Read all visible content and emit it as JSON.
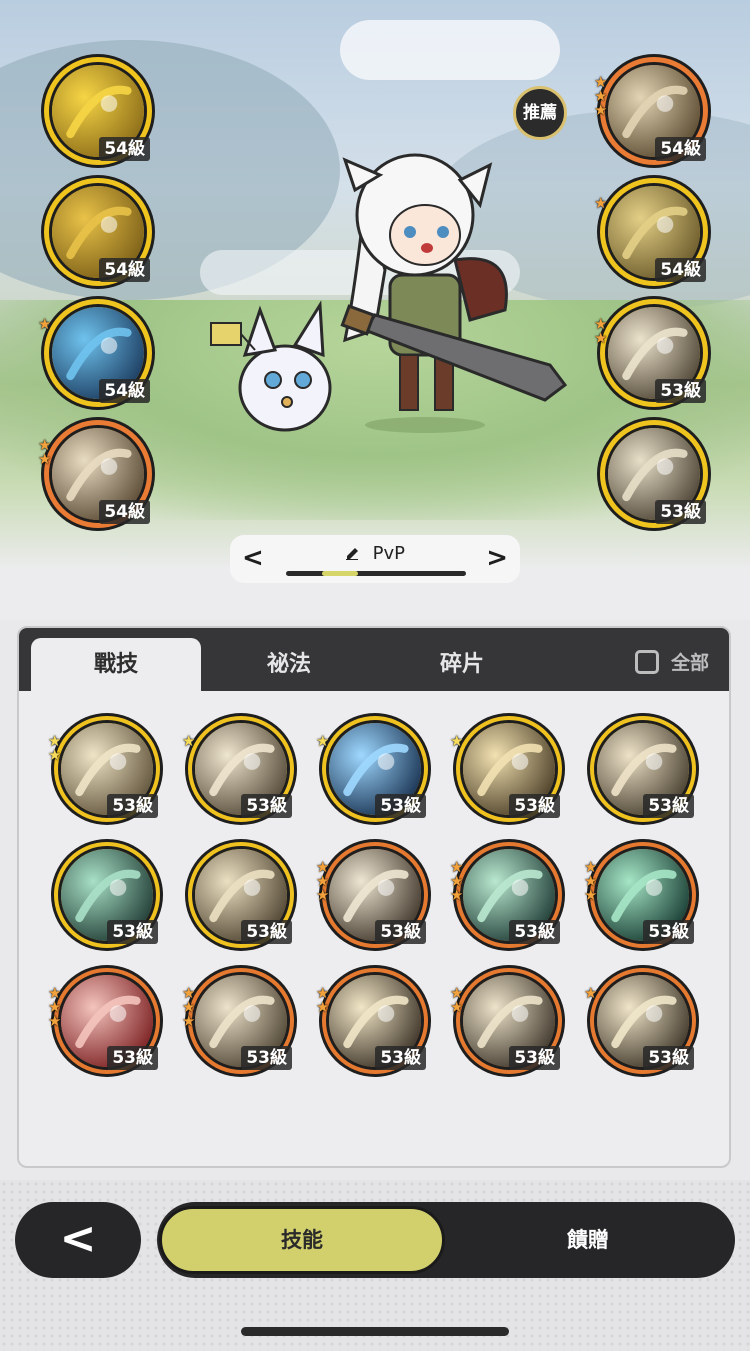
{
  "scene": {
    "recommend_label": "推薦",
    "left_slots": [
      {
        "level": "54級",
        "frame": "gold",
        "stars": 0,
        "icon": "golden-crystal-arrows-icon"
      },
      {
        "level": "54級",
        "frame": "gold",
        "stars": 0,
        "icon": "golden-rune-square-icon"
      },
      {
        "level": "54級",
        "frame": "gold",
        "stars": 1,
        "icon": "blue-magic-circle-icon"
      },
      {
        "level": "54級",
        "frame": "bronze",
        "stars": 2,
        "icon": "sword-slash-icon"
      }
    ],
    "right_slots": [
      {
        "level": "54級",
        "frame": "bronze",
        "stars": 3,
        "icon": "flexing-arm-icon"
      },
      {
        "level": "54級",
        "frame": "gold",
        "stars": 1,
        "icon": "golem-figure-icon"
      },
      {
        "level": "53級",
        "frame": "gold",
        "stars": 2,
        "icon": "sword-compass-icon"
      },
      {
        "level": "53級",
        "frame": "gold",
        "stars": 0,
        "icon": "swirling-blade-icon"
      }
    ],
    "loadout": {
      "name": "PvP",
      "edit_icon": "pencil-icon",
      "prev_label": "<",
      "next_label": ">",
      "page_fraction": 0.2
    }
  },
  "panel": {
    "tabs": [
      {
        "label": "戰技",
        "active": true
      },
      {
        "label": "祕法",
        "active": false
      },
      {
        "label": "碎片",
        "active": false
      }
    ],
    "all_toggle_label": "全部",
    "skills": [
      {
        "level": "53級",
        "frame": "gold",
        "stars": 2,
        "star_color": "gold",
        "icon": "rock-burst-icon"
      },
      {
        "level": "53級",
        "frame": "gold",
        "stars": 1,
        "star_color": "gold",
        "icon": "wind-slash-icon"
      },
      {
        "level": "53級",
        "frame": "gold",
        "stars": 1,
        "star_color": "gold",
        "icon": "ice-crystal-icon"
      },
      {
        "level": "53級",
        "frame": "gold",
        "stars": 1,
        "star_color": "gold",
        "icon": "explosion-icon"
      },
      {
        "level": "53級",
        "frame": "gold",
        "stars": 0,
        "star_color": "gold",
        "icon": "crescent-slash-icon"
      },
      {
        "level": "53級",
        "frame": "gold",
        "stars": 0,
        "star_color": "gold",
        "icon": "green-crescent-icon"
      },
      {
        "level": "53級",
        "frame": "gold",
        "stars": 0,
        "star_color": "gold",
        "icon": "spike-eruption-icon"
      },
      {
        "level": "53級",
        "frame": "bronze",
        "stars": 3,
        "star_color": "orange",
        "icon": "key-strike-icon"
      },
      {
        "level": "53級",
        "frame": "bronze",
        "stars": 3,
        "star_color": "orange",
        "icon": "spider-web-icon"
      },
      {
        "level": "53級",
        "frame": "bronze",
        "stars": 3,
        "star_color": "orange",
        "icon": "green-sword-icon"
      },
      {
        "level": "53級",
        "frame": "bronze",
        "stars": 3,
        "star_color": "orange",
        "icon": "red-blade-icon"
      },
      {
        "level": "53級",
        "frame": "bronze",
        "stars": 3,
        "star_color": "orange",
        "icon": "boulder-smash-icon"
      },
      {
        "level": "53級",
        "frame": "bronze",
        "stars": 2,
        "star_color": "orange",
        "icon": "sparkle-orbit-icon"
      },
      {
        "level": "53級",
        "frame": "bronze",
        "stars": 2,
        "star_color": "orange",
        "icon": "whirl-slash-icon"
      },
      {
        "level": "53級",
        "frame": "bronze",
        "stars": 1,
        "star_color": "orange",
        "icon": "horn-blast-icon"
      }
    ]
  },
  "bottom_nav": {
    "back_label": "<",
    "tabs": [
      {
        "label": "技能",
        "active": true
      },
      {
        "label": "饋贈",
        "active": false
      }
    ]
  },
  "colors": {
    "gold_frame": "#efc21f",
    "bronze_frame": "#e5792f",
    "accent": "#d2d06d",
    "dark": "#262628"
  }
}
